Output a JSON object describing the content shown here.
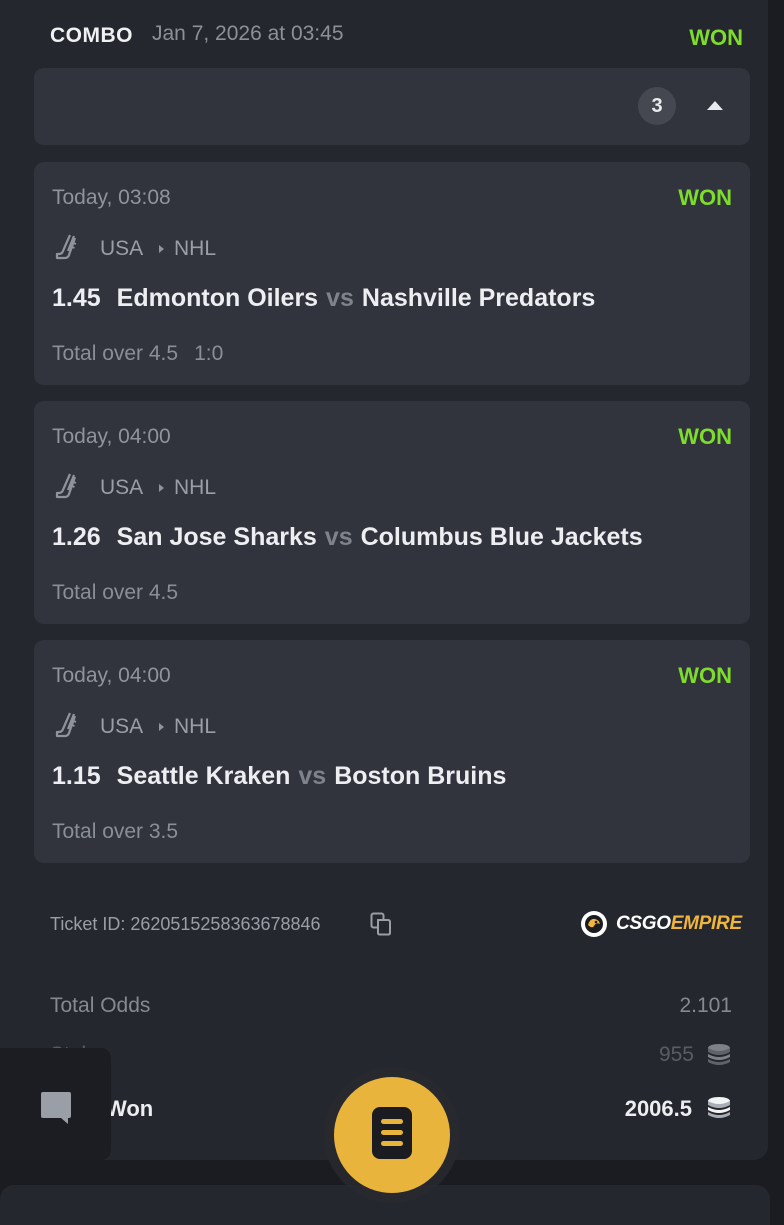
{
  "header": {
    "type": "COMBO",
    "date": "Jan 7, 2026 at 03:45",
    "status": "WON"
  },
  "collapse": {
    "count": "3",
    "icon": "caret-up-icon"
  },
  "legs": [
    {
      "time": "Today, 03:08",
      "status": "WON",
      "sport_icon": "hockey-stick-icon",
      "country": "USA",
      "league": "NHL",
      "odds": "1.45",
      "home": "Edmonton Oilers",
      "vs": "vs",
      "away": "Nashville Predators",
      "market": "Total over 4.5",
      "score": "1:0"
    },
    {
      "time": "Today, 04:00",
      "status": "WON",
      "sport_icon": "hockey-stick-icon",
      "country": "USA",
      "league": "NHL",
      "odds": "1.26",
      "home": "San Jose Sharks",
      "vs": "vs",
      "away": "Columbus Blue Jackets",
      "market": "Total over 4.5",
      "score": ""
    },
    {
      "time": "Today, 04:00",
      "status": "WON",
      "sport_icon": "hockey-stick-icon",
      "country": "USA",
      "league": "NHL",
      "odds": "1.15",
      "home": "Seattle Kraken",
      "vs": "vs",
      "away": "Boston Bruins",
      "market": "Total over 3.5",
      "score": ""
    }
  ],
  "ticket": {
    "id_label": "Ticket ID: 2620515258363678846"
  },
  "brand": {
    "csgo": "CSGO",
    "empire": "EMPIRE"
  },
  "summary": {
    "total_odds_label": "Total Odds",
    "total_odds": "2.101",
    "stake_label": "Stake",
    "stake": "955",
    "won_label": "Won",
    "won": "2006.5"
  },
  "colors": {
    "won": "#7ddc2c",
    "accent": "#e9b43b",
    "card": "#31343c",
    "panel": "#25272e"
  }
}
